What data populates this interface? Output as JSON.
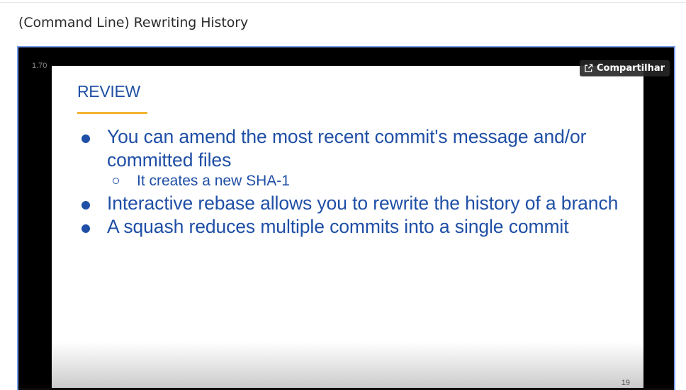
{
  "page": {
    "title": "(Command Line) Rewriting History"
  },
  "player": {
    "playback_rate": "1.70",
    "share_label": "Compartilhar",
    "share_icon": "share-external-icon"
  },
  "slide": {
    "heading": "REVIEW",
    "accent_color": "#f2b431",
    "text_color": "#1f4fa6",
    "bullets": [
      {
        "text": "You can amend the most recent commit's message and/or committed files"
      },
      {
        "text": "Interactive rebase allows you to rewrite the history of a branch"
      },
      {
        "text": "A squash reduces multiple commits into a single commit"
      }
    ],
    "sub_bullets": [
      {
        "text": "It creates a new SHA-1"
      }
    ],
    "number": "19"
  }
}
